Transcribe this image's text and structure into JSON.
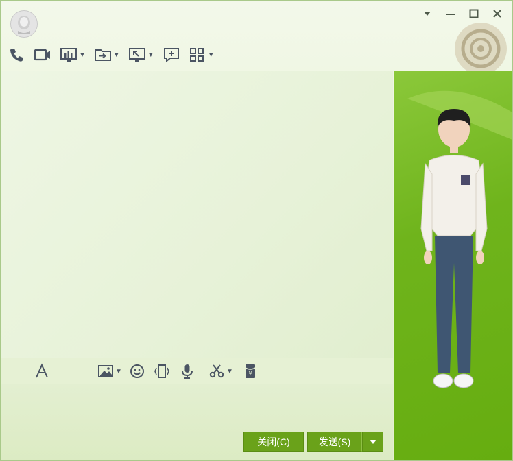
{
  "window": {
    "controls": [
      "dropdown",
      "minimize",
      "maximize",
      "close"
    ]
  },
  "toolbar": {
    "items": [
      {
        "name": "phone-icon",
        "has_caret": false
      },
      {
        "name": "video-icon",
        "has_caret": false
      },
      {
        "name": "screen-share-icon",
        "has_caret": true
      },
      {
        "name": "file-transfer-icon",
        "has_caret": true
      },
      {
        "name": "remote-desktop-icon",
        "has_caret": true
      },
      {
        "name": "new-discussion-icon",
        "has_caret": false
      },
      {
        "name": "apps-grid-icon",
        "has_caret": true
      }
    ]
  },
  "input_toolbar": {
    "items": [
      "font-icon",
      "image-icon",
      "emoji-icon",
      "shake-icon",
      "voice-icon",
      "screenshot-icon",
      "red-packet-icon"
    ]
  },
  "buttons": {
    "close_label": "关闭(C)",
    "send_label": "发送(S)"
  },
  "colors": {
    "accent": "#6aa21a",
    "panel_green": "#6fb41c",
    "background": "#e9f3da"
  }
}
